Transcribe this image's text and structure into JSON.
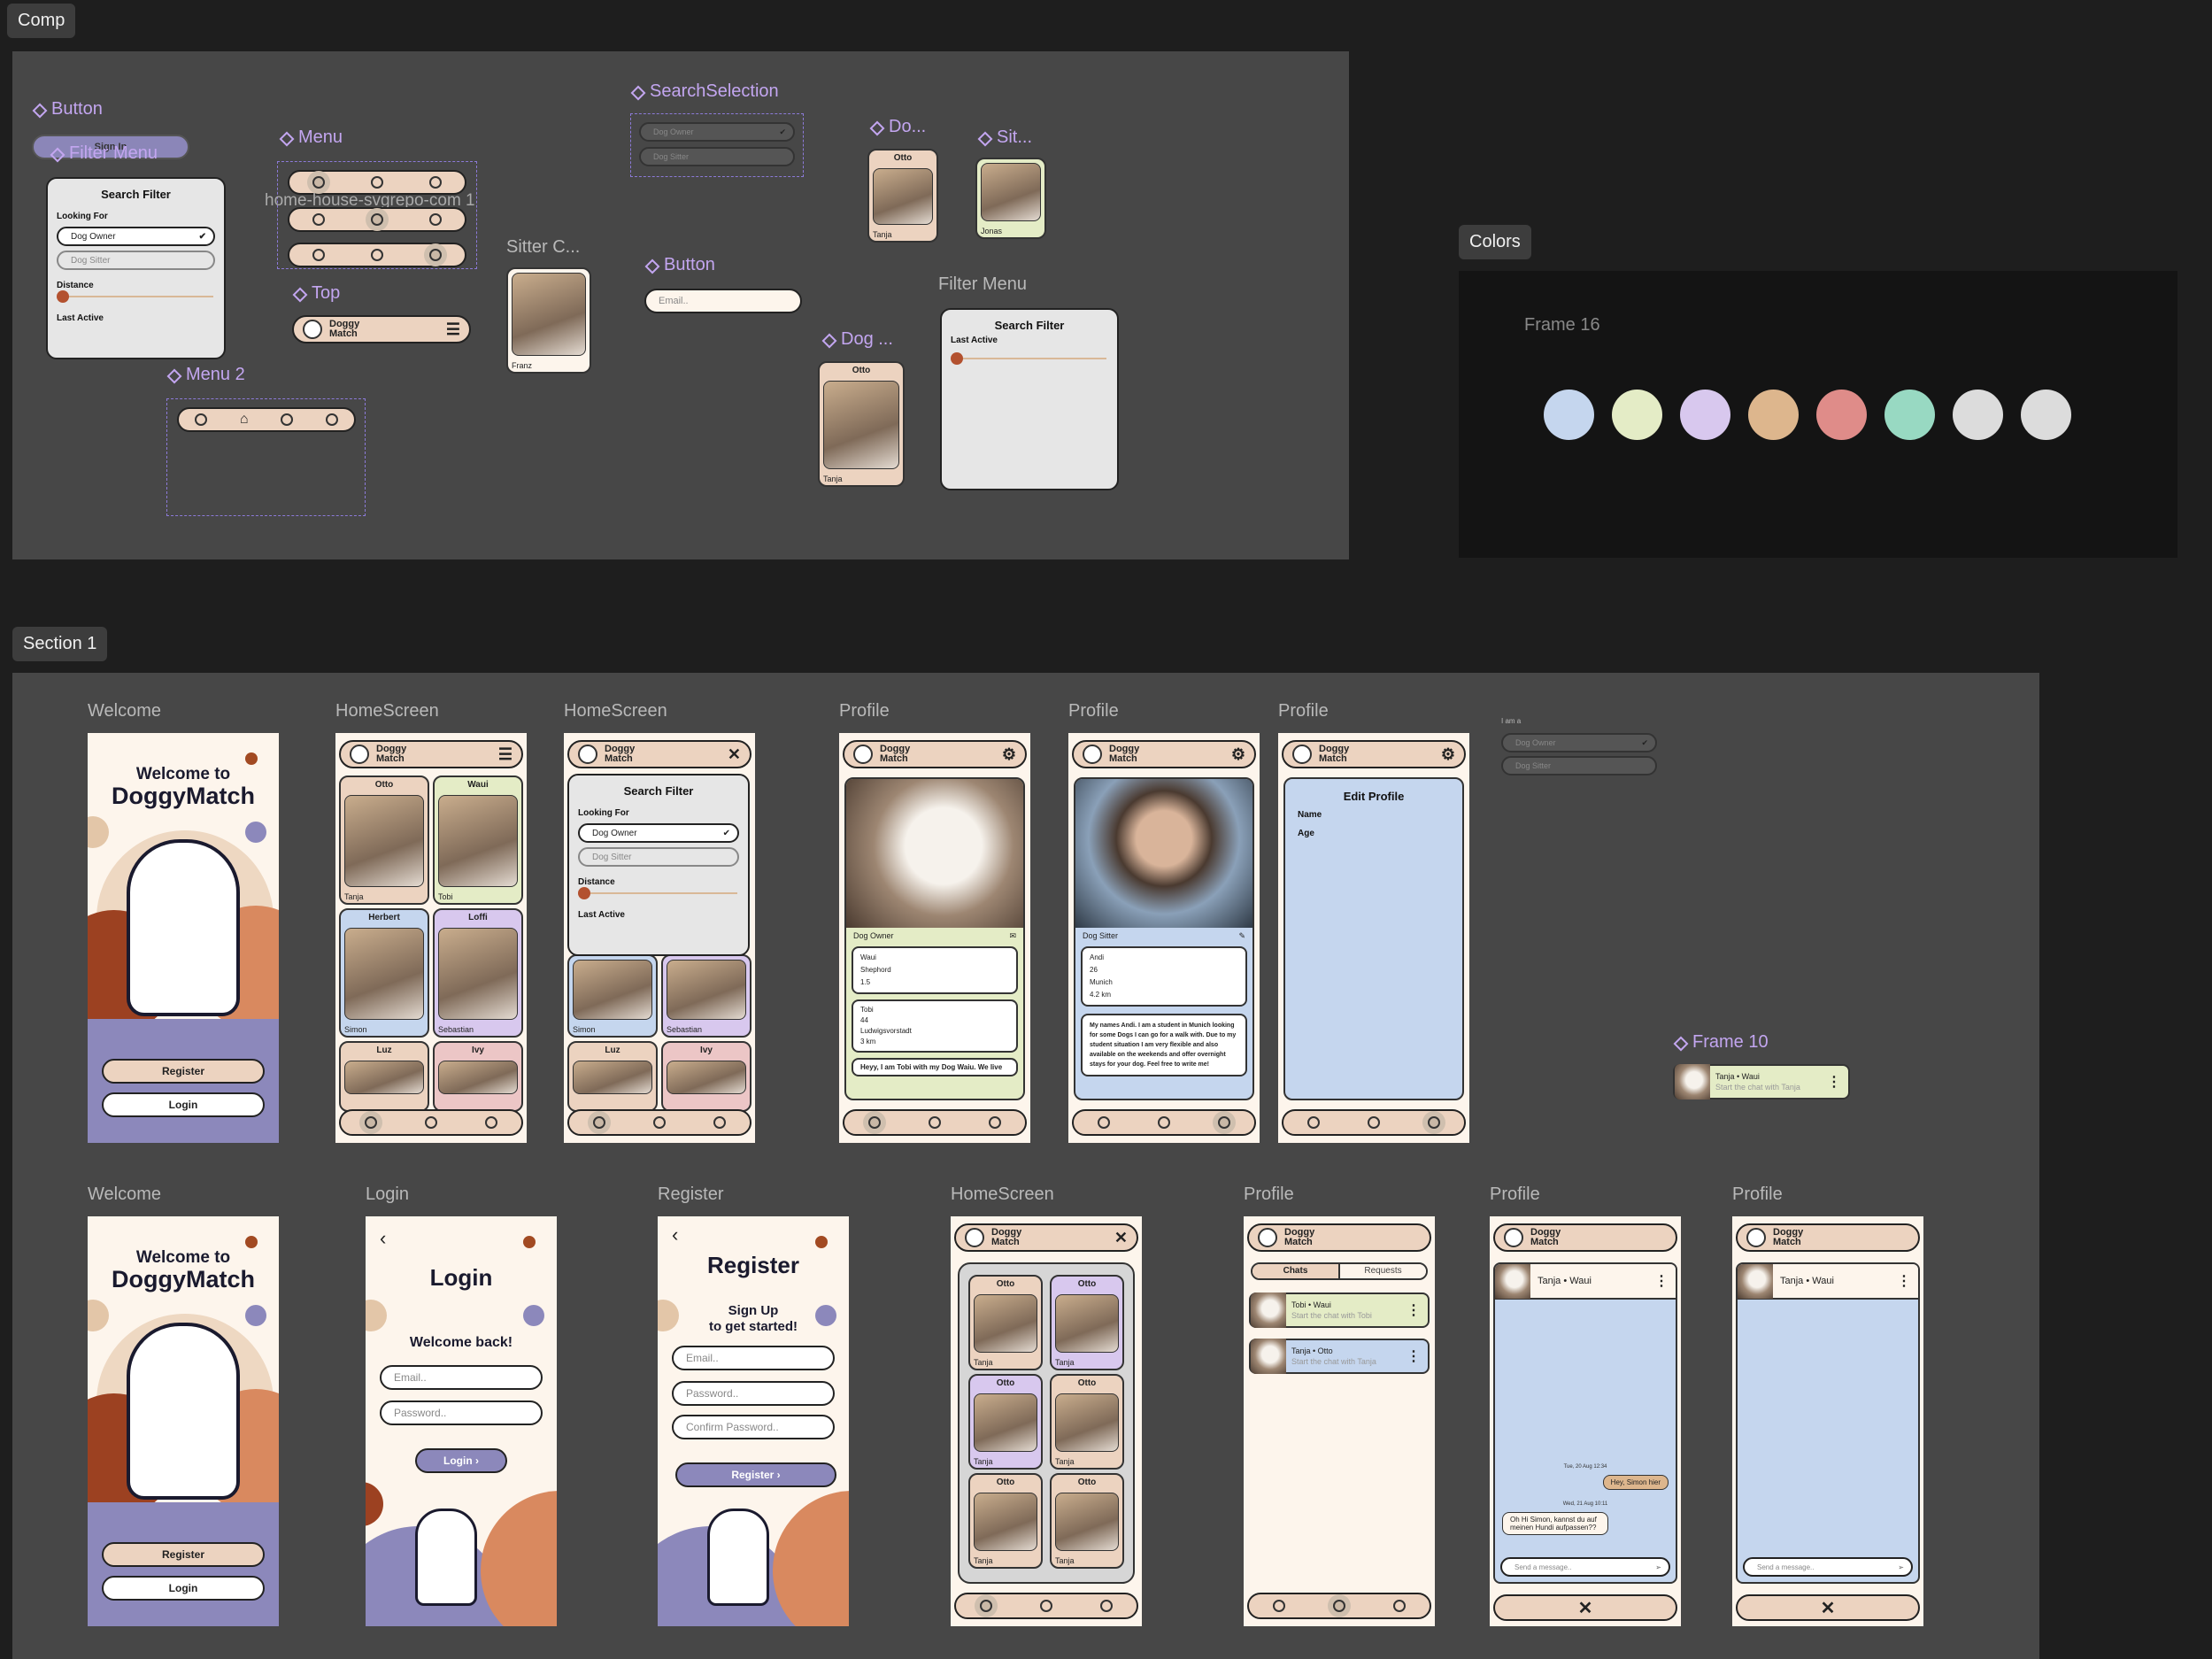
{
  "sections": {
    "comp": "Comp",
    "colors": "Colors",
    "section1": "Section 1"
  },
  "comp": {
    "button_label": "Button",
    "button_text": "Sign In",
    "filter_menu_label": "Filter Menu",
    "menu_label": "Menu",
    "home_house_label": "home-house-svgrepo-com 1",
    "top_label": "Top",
    "menu2_label": "Menu 2",
    "sitter_card_label": "Sitter C...",
    "search_selection_label": "SearchSelection",
    "button2_label": "Button",
    "email_placeholder": "Email..",
    "dog_short_label": "Do...",
    "sit_short_label": "Sit...",
    "dog_card_label": "Dog ...",
    "filter_menu2_label": "Filter Menu",
    "search_filter": "Search Filter",
    "looking_for": "Looking For",
    "dog_owner": "Dog Owner",
    "dog_sitter": "Dog Sitter",
    "distance": "Distance",
    "last_active": "Last Active",
    "brand_top": "Doggy",
    "brand_bottom": "Match",
    "otto": "Otto",
    "tanja": "Tanja",
    "jonas": "Jonas",
    "franz": "Franz"
  },
  "colors": {
    "frame_label": "Frame 16",
    "swatches": [
      "#c5d6ee",
      "#e4ecc6",
      "#d8c8ee",
      "#ddb68d",
      "#df8c89",
      "#98d9c2",
      "#dcdcdc",
      "#dcdcdc"
    ]
  },
  "row1": {
    "welcome_label": "Welcome",
    "home1_label": "HomeScreen",
    "home2_label": "HomeScreen",
    "profile1_label": "Profile",
    "profile2_label": "Profile",
    "profile3_label": "Profile",
    "welcome_title1": "Welcome to",
    "welcome_title2": "DoggyMatch",
    "register": "Register",
    "login": "Login",
    "cards": [
      {
        "name": "Otto",
        "owner": "Tanja"
      },
      {
        "name": "Waui",
        "owner": "Tobi"
      },
      {
        "name": "Herbert",
        "owner": "Simon"
      },
      {
        "name": "Loffi",
        "owner": "Sebastian"
      },
      {
        "name": "Luz",
        "owner": ""
      },
      {
        "name": "Ivy",
        "owner": ""
      }
    ],
    "profile_dog_role": "Dog Owner",
    "profile_dog_info": [
      "Waui",
      "Shephord",
      "1.5"
    ],
    "profile_owner_info": [
      "Tobi",
      "44",
      "Ludwigsvorstadt",
      "3 km"
    ],
    "profile_dog_bio": "Heyy, I am Tobi with my Dog Waiu. We live",
    "profile_sitter_role": "Dog Sitter",
    "profile_sitter_info": [
      "Andi",
      "26",
      "Munich",
      "4.2 km"
    ],
    "profile_sitter_bio": "My names Andi. I am a student in Munich looking for some Dogs I can go for a walk with. Due to my student situation I am very flexible and also available on the weekends and offer overnight stays for your dog. Feel free to write me!",
    "edit_profile": "Edit Profile",
    "edit_name": "Name",
    "edit_age": "Age",
    "iam": "I am a",
    "frame10_label": "Frame 10",
    "frame10_text": "Tanja • Waui",
    "frame10_sub": "Start the chat with Tanja"
  },
  "row2": {
    "welcome_label": "Welcome",
    "login_label": "Login",
    "register_label": "Register",
    "home_label": "HomeScreen",
    "profile1_label": "Profile",
    "profile2_label": "Profile",
    "profile3_label": "Profile",
    "login_title": "Login",
    "welcome_back": "Welcome back!",
    "email": "Email..",
    "password": "Password..",
    "login_btn": "Login ›",
    "register_title": "Register",
    "signup1": "Sign Up",
    "signup2": "to get started!",
    "confirm": "Confirm Password..",
    "register_btn": "Register ›",
    "tabs": [
      "Chats",
      "Requests"
    ],
    "chat1": "Tobi • Waui",
    "chat1_sub": "Start the chat with Tobi",
    "chat2": "Tanja • Otto",
    "chat2_sub": "Start the chat with Tanja",
    "chat_head": "Tanja • Waui",
    "date1": "Tue, 20 Aug 12:34",
    "msg1": "Hey, Simon hier",
    "date2": "Wed, 21 Aug 10:11",
    "msg2": "Oh Hi Simon, kannst du auf meinen Hundi aufpassen??",
    "send": "Send a message..",
    "otto": "Otto",
    "tanja": "Tanja"
  }
}
